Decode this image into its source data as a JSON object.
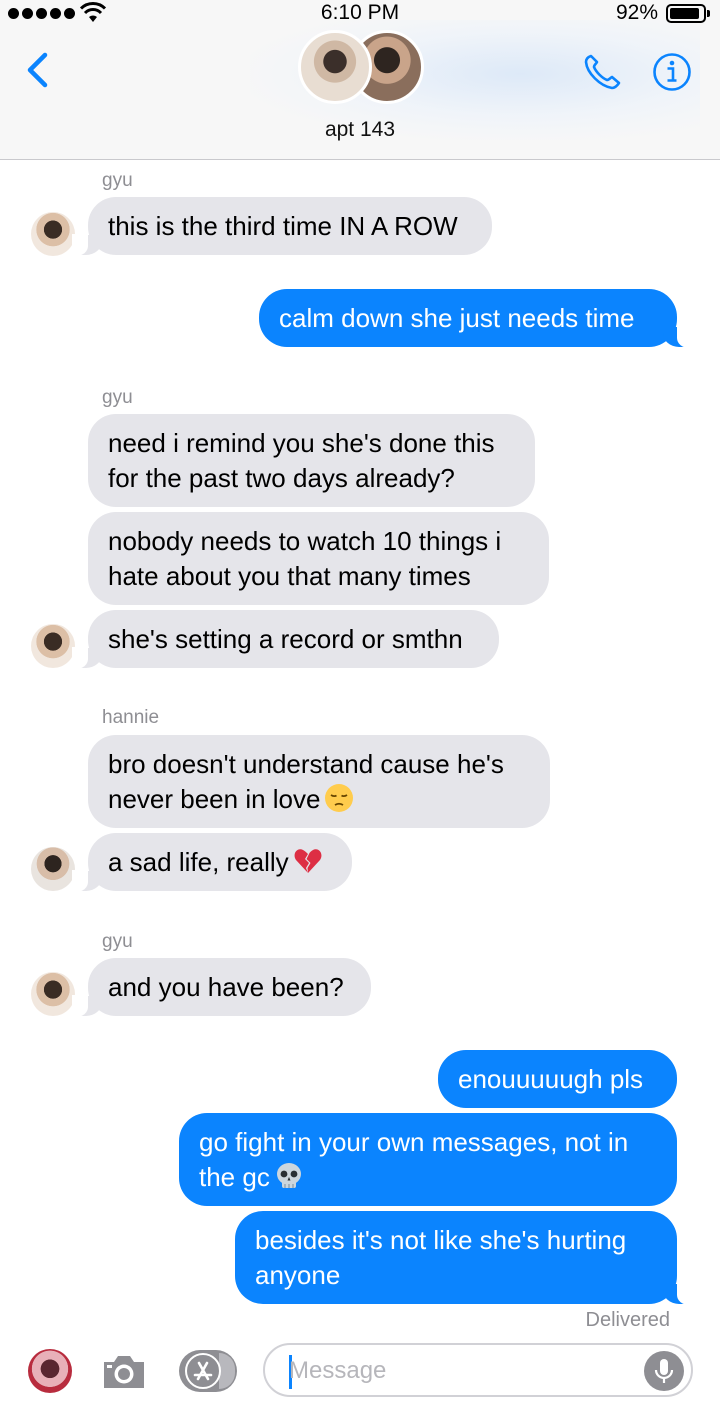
{
  "status_bar": {
    "time": "6:10 PM",
    "battery_percent": "92%",
    "battery_level": 0.92,
    "signal_icon": "signal-dots-icon",
    "wifi_icon": "wifi-icon"
  },
  "header": {
    "title": "apt 143",
    "back_icon": "chevron-left-icon",
    "call_icon": "phone-icon",
    "info_icon": "info-icon"
  },
  "messages": [
    {
      "type": "sender",
      "text": "gyu"
    },
    {
      "type": "in",
      "from": "gyu",
      "lines": [
        "this is the third time IN A ROW"
      ]
    },
    {
      "type": "out",
      "lines": [
        "calm down she just needs time"
      ]
    },
    {
      "type": "sender",
      "text": "gyu"
    },
    {
      "type": "in",
      "from": "gyu",
      "lines": [
        "need i remind you she's done this",
        "for the past two days already?"
      ]
    },
    {
      "type": "in",
      "from": "gyu",
      "lines": [
        "nobody needs to watch 10 things i",
        "hate about you that many times"
      ]
    },
    {
      "type": "in",
      "from": "gyu",
      "lines": [
        "she's setting a record or smthn"
      ]
    },
    {
      "type": "sender",
      "text": "hannie"
    },
    {
      "type": "in",
      "from": "hannie",
      "lines": [
        "bro doesn't understand cause he's",
        "never been in love"
      ],
      "emoji": "pensive-face-emoji"
    },
    {
      "type": "in",
      "from": "hannie",
      "lines": [
        "a sad life, really"
      ],
      "emoji": "broken-heart-emoji"
    },
    {
      "type": "sender",
      "text": "gyu"
    },
    {
      "type": "in",
      "from": "gyu",
      "lines": [
        "and you have been?"
      ]
    },
    {
      "type": "out",
      "lines": [
        "enouuuuugh pls"
      ]
    },
    {
      "type": "out",
      "lines": [
        "go fight in your own messages, not in",
        "the gc"
      ],
      "emoji": "skull-emoji"
    },
    {
      "type": "out",
      "lines": [
        "besides it's not like she's hurting",
        "anyone"
      ]
    }
  ],
  "delivered_label": "Delivered",
  "input_bar": {
    "placeholder": "Message",
    "camera_icon": "camera-icon",
    "apps_icon": "app-store-icon",
    "mic_icon": "microphone-icon"
  },
  "colors": {
    "outgoing_bubble": "#0b84fe",
    "incoming_bubble": "#e5e5ea",
    "accent": "#0b84fe",
    "meta_text": "#8e8e93"
  }
}
